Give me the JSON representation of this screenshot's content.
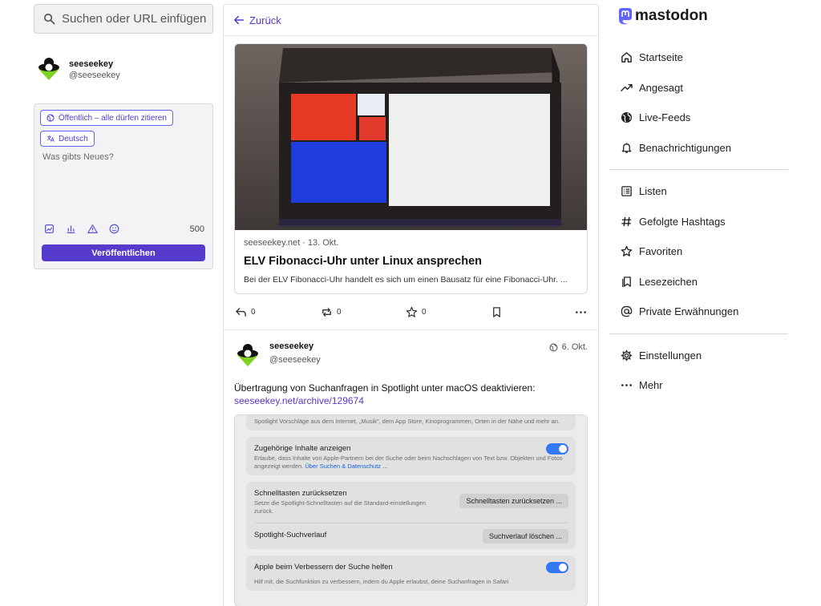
{
  "search": {
    "placeholder": "Suchen oder URL einfügen"
  },
  "me": {
    "name": "seeseekey",
    "handle": "@seeseekey"
  },
  "compose": {
    "visibility_label": "Öffentlich – alle dürfen zitieren",
    "language_label": "Deutsch",
    "placeholder": "Was gibts Neues?",
    "char_count": "500",
    "publish_label": "Veröffentlichen",
    "tools": [
      "media-icon",
      "poll-icon",
      "warning-icon",
      "emoji-icon"
    ]
  },
  "main": {
    "back_label": "Zurück",
    "card": {
      "meta": "seeseekey.net · 13. Okt.",
      "title": "ELV Fibonacci-Uhr unter Linux ansprechen",
      "description": "Bei der ELV Fibonacci-Uhr handelt es sich um einen Bausatz für eine Fibonacci-Uhr. ..."
    },
    "actions": {
      "reply": "0",
      "boost": "0",
      "favourite": "0"
    },
    "post": {
      "author_name": "seeseekey",
      "author_handle": "@seeseekey",
      "date": "6. Okt.",
      "text": "Übertragung von Suchanfragen in Spotlight unter macOS deaktivieren:",
      "link": "seeseekey.net/archive/129674",
      "screenshot": {
        "top_text": "Spotlight Vorschläge aus dem Internet, „Musik“, dem App Store, Kinoprogrammen, Orten in der Nähe und mehr an.",
        "related_title": "Zugehörige Inhalte anzeigen",
        "related_desc": "Erlaube, dass Inhalte von Apple-Partnern bei der Suche oder beim Nachschlagen von Text bzw. Objekten und Fotos angezeigt werden.",
        "related_link": "Über Suchen & Datenschutz ...",
        "shortcuts_title": "Schnelltasten zurücksetzen",
        "shortcuts_desc": "Setze die Spotlight-Schnelltasten auf die Standard-einstellungen zurück.",
        "shortcuts_button": "Schnelltasten zurücksetzen ...",
        "history_title": "Spotlight-Suchverlauf",
        "history_button": "Suchverlauf löschen ...",
        "improve_title": "Apple beim Verbessern der Suche helfen",
        "improve_desc": "Hilf mit, die Suchfunktion zu verbessern, indem du Apple erlaubst, deine Suchanfragen in Safari"
      }
    }
  },
  "brand": {
    "logo_text": "mastodon",
    "accent": "#563acc"
  },
  "nav": {
    "items": [
      {
        "label": "Startseite",
        "icon": "home-icon"
      },
      {
        "label": "Angesagt",
        "icon": "trending-icon"
      },
      {
        "label": "Live-Feeds",
        "icon": "globe-icon"
      },
      {
        "label": "Benachrichtigungen",
        "icon": "bell-icon"
      },
      {
        "label": "Listen",
        "icon": "list-icon"
      },
      {
        "label": "Gefolgte Hashtags",
        "icon": "hashtag-icon"
      },
      {
        "label": "Favoriten",
        "icon": "star-icon"
      },
      {
        "label": "Lesezeichen",
        "icon": "bookmarks-icon"
      },
      {
        "label": "Private Erwähnungen",
        "icon": "at-icon"
      },
      {
        "label": "Einstellungen",
        "icon": "gear-icon"
      },
      {
        "label": "Mehr",
        "icon": "more-icon"
      }
    ]
  }
}
